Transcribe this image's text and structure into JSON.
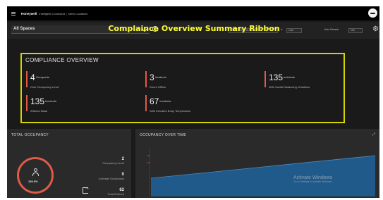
{
  "header": {
    "brand": "Honeywell",
    "app_name": "Intelligent Command",
    "separator": "|",
    "page": "Idem Locations"
  },
  "filter": {
    "space_label": "All Spaces",
    "date_range": "13-03-2020 - 13-03-2020",
    "date_clear": "✕",
    "period": "Last",
    "auto_refresh_label": "Auto Refresh",
    "auto_refresh_value": "10s"
  },
  "ribbon_caption": "Complaince Overview Summary Ribbon",
  "compliance": {
    "title": "COMPLIANCE OVERVIEW",
    "metrics": [
      {
        "value": "4",
        "unit": "Occupants",
        "desc": "Over Occupancy Level"
      },
      {
        "value": "3",
        "unit": "Incidents",
        "desc": "Doors Offline"
      },
      {
        "value": "135",
        "unit": "Incidents",
        "desc": "With Social Distancing Violations"
      },
      {
        "value": "135",
        "unit": "Incidents",
        "desc": "Without Mask"
      },
      {
        "value": "67",
        "unit": "Incidents",
        "desc": "With Elevated Body Temperature"
      }
    ]
  },
  "occupancy": {
    "title": "TOTAL OCCUPANCY",
    "gauge_value": "100.0%",
    "stats": [
      {
        "value": "2",
        "label": "Occupancy Level"
      },
      {
        "value": "0",
        "label": "Average Occupancy"
      },
      {
        "value": "62",
        "label": "Total Entered"
      }
    ]
  },
  "trend": {
    "title": "OCCUPANCY OVER TIME",
    "expand_icon": "expand-icon",
    "watermark_title": "Activate Windows",
    "watermark_sub": "Go to Settings to activate Windows."
  },
  "colors": {
    "accent_red": "#e05a46",
    "ribbon_yellow": "#d4d400",
    "caption_yellow": "#ffff33",
    "area_blue": "#1f5a8a"
  },
  "icons": [
    "menu-icon",
    "avatar",
    "chevron-down-icon",
    "info-icon",
    "gear-icon",
    "person-icon",
    "exit-icon",
    "expand-icon"
  ]
}
